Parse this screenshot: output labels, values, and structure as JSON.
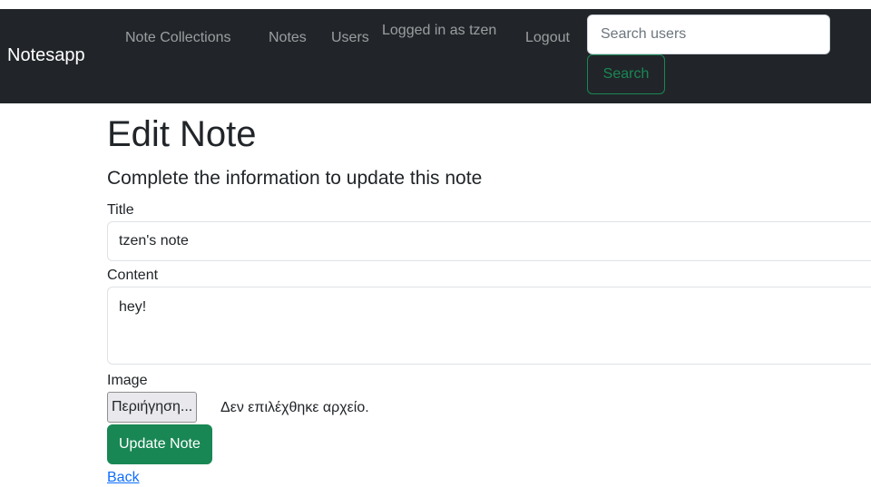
{
  "navbar": {
    "brand": "Notesapp",
    "links": {
      "note_collections": "Note Collections",
      "notes": "Notes",
      "users": "Users",
      "logout": "Logout"
    },
    "logged_in_text": "Logged in as tzen",
    "search": {
      "placeholder": "Search users",
      "button_label": "Search"
    },
    "colors": {
      "background": "#212529",
      "search_accent": "#198754"
    }
  },
  "page": {
    "title": "Edit Note",
    "subtitle": "Complete the information to update this note"
  },
  "form": {
    "title_label": "Title",
    "title_value": "tzen's note",
    "content_label": "Content",
    "content_value": "hey!",
    "image_label": "Image",
    "file_button_label": "Περιήγηση...",
    "file_status": "Δεν επιλέχθηκε αρχείο.",
    "submit_label": "Update Note",
    "back_label": "Back",
    "colors": {
      "submit": "#198754",
      "link": "#0d6efd"
    }
  }
}
